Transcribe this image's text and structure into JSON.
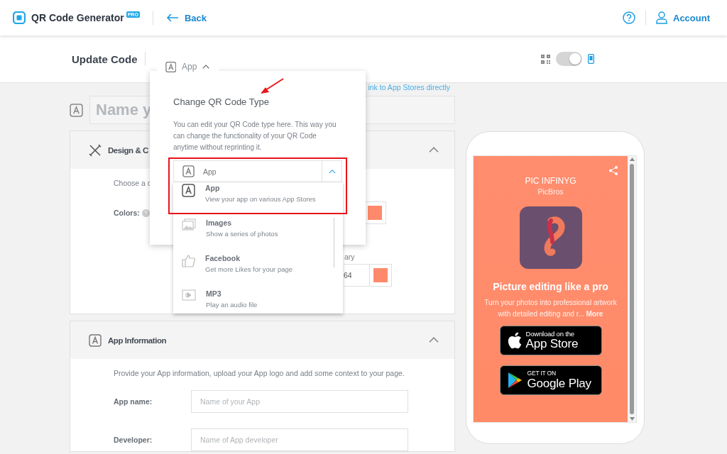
{
  "header": {
    "logo": "QR Code Generator",
    "badge": "PRO",
    "back": "Back",
    "account": "Account"
  },
  "subheader": {
    "title": "Update Code",
    "type_button": "App",
    "view_toggle": {
      "on": true
    }
  },
  "link": "ink to App Stores directly",
  "name_field": {
    "placeholder": "Name y"
  },
  "design_panel": {
    "title": "Design & C",
    "expanded": true,
    "intro": "Choose a c",
    "colors_label": "Colors:",
    "secondary_label": "ary",
    "secondary_value": "64"
  },
  "app_panel": {
    "title": "App Information",
    "expanded": true,
    "intro": "Provide your App information, upload your App logo and add some context to your page.",
    "fields": [
      {
        "label": "App name:",
        "placeholder": "Name of your App"
      },
      {
        "label": "Developer:",
        "placeholder": "Name of App developer"
      }
    ]
  },
  "popover": {
    "title": "Change QR Code Type",
    "text": "You can edit your QR Code type here. This way you can change the functionality of your QR Code anytime without reprinting it.",
    "select": {
      "value": "App",
      "expanded": true
    },
    "options": [
      {
        "kind": "app",
        "title": "App",
        "subtitle": "View your app on various App Stores"
      },
      {
        "kind": "images",
        "title": "Images",
        "subtitle": "Show a series of photos"
      },
      {
        "kind": "facebook",
        "title": "Facebook",
        "subtitle": "Get more Likes for your page"
      },
      {
        "kind": "mp3",
        "title": "MP3",
        "subtitle": "Play an audio file"
      }
    ]
  },
  "preview": {
    "app_title": "PIC INFINYG",
    "developer": "PicBros",
    "headline": "Picture editing like a pro",
    "description": "Turn your photos into professional artwork with detailed editing and r...",
    "more": "More",
    "stores": [
      {
        "kind": "apple",
        "small": "Download on the",
        "large": "App Store"
      },
      {
        "kind": "google",
        "small": "GET IT ON",
        "large": "Google Play"
      }
    ]
  }
}
